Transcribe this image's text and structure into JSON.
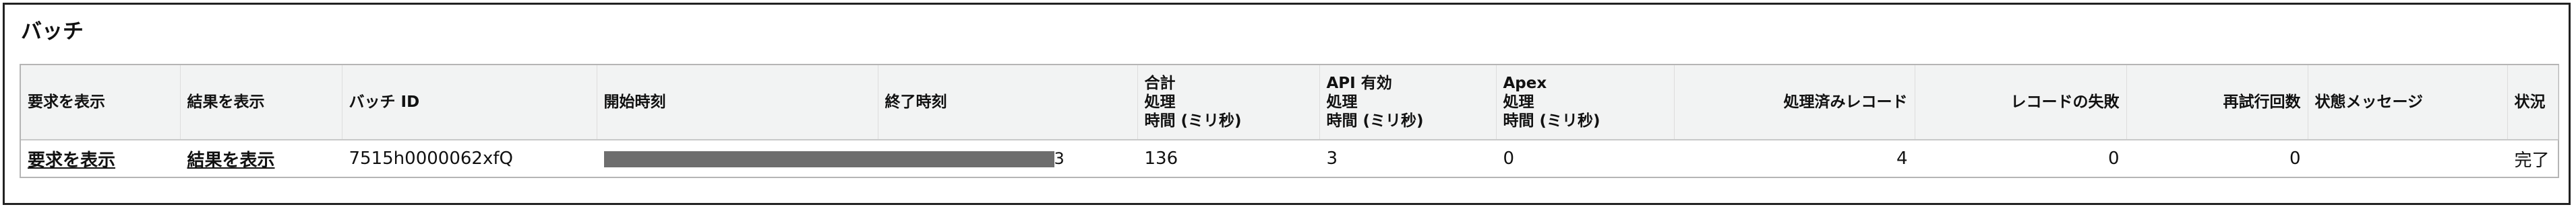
{
  "section": {
    "title": "バッチ"
  },
  "table": {
    "headers": {
      "view_request": "要求を表示",
      "view_result": "結果を表示",
      "batch_id": "バッチ ID",
      "start_time": "開始時刻",
      "end_time": "終了時刻",
      "total_processing": [
        "合計",
        "処理",
        "時間 (ミリ秒)"
      ],
      "api_active_processing": [
        "API 有効",
        "処理",
        "時間 (ミリ秒)"
      ],
      "apex_processing": [
        "Apex",
        "処理",
        "時間 (ミリ秒)"
      ],
      "records_processed": "処理済みレコード",
      "records_failed": "レコードの失敗",
      "retries": "再試行回数",
      "state_message": "状態メッセージ",
      "status": "状況"
    },
    "rows": [
      {
        "view_request": "要求を表示",
        "view_result": "結果を表示",
        "batch_id": "7515h0000062xfQ",
        "time_tail": "3",
        "total_processing": "136",
        "api_active_processing": "3",
        "apex_processing": "0",
        "records_processed": "4",
        "records_failed": "0",
        "retries": "0",
        "state_message": "",
        "status": "完了"
      }
    ]
  },
  "colors": {
    "frame_border": "#222222",
    "header_background": "#f2f3f3",
    "redaction": "#6e6e6e"
  }
}
